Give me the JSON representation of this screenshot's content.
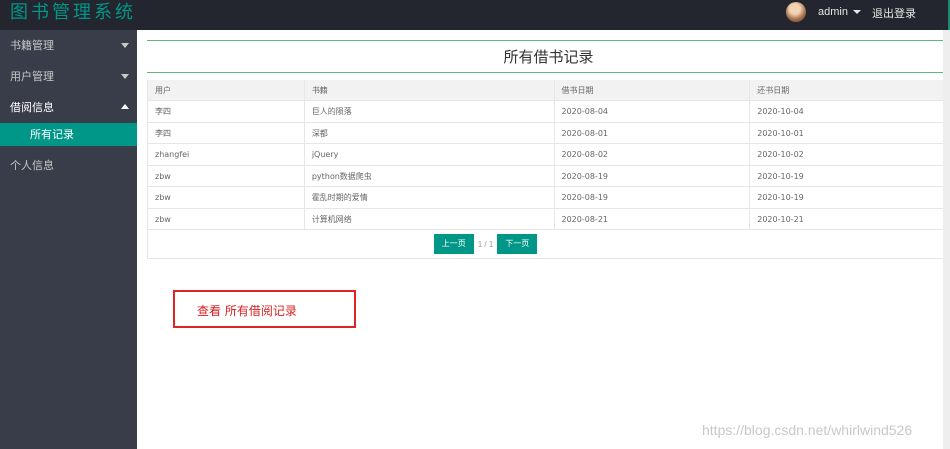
{
  "app": {
    "title": "图书管理系统",
    "username": "admin",
    "logout_label": "退出登录"
  },
  "sidebar": {
    "items": [
      {
        "label": "书籍管理"
      },
      {
        "label": "用户管理"
      },
      {
        "label": "借阅信息"
      },
      {
        "label": "个人信息"
      }
    ],
    "sub_items": [
      {
        "label": "所有记录"
      }
    ]
  },
  "main": {
    "page_title": "所有借书记录",
    "table": {
      "headers": [
        "用户",
        "书籍",
        "借书日期",
        "还书日期"
      ],
      "rows": [
        [
          "李四",
          "巨人的陨落",
          "2020-08-04",
          "2020-10-04"
        ],
        [
          "李四",
          "深都",
          "2020-08-01",
          "2020-10-01"
        ],
        [
          "zhangfei",
          "jQuery",
          "2020-08-02",
          "2020-10-02"
        ],
        [
          "zbw",
          "python数据爬虫",
          "2020-08-19",
          "2020-10-19"
        ],
        [
          "zbw",
          "霍乱时期的爱情",
          "2020-08-19",
          "2020-10-19"
        ],
        [
          "zbw",
          "计算机网络",
          "2020-08-21",
          "2020-10-21"
        ]
      ]
    },
    "pager": {
      "prev_label": "上一页",
      "info": "1 / 1",
      "next_label": "下一页"
    }
  },
  "annotation": {
    "text": "查看 所有借阅记录"
  },
  "watermark": "https://blog.csdn.net/whirlwind526",
  "colors": {
    "accent": "#009688",
    "topbar": "#23262e",
    "sidebar": "#393d49",
    "annotation_red": "#e02424"
  }
}
